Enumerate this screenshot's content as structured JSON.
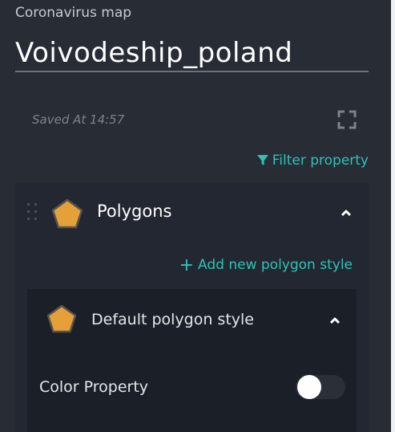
{
  "header": {
    "map_name": "Coronavirus map",
    "title": "Voivodeship_poland",
    "saved_text": "Saved At 14:57"
  },
  "toolbar": {
    "filter_label": "Filter property",
    "expand_icon": "expand-icon"
  },
  "layer": {
    "title": "Polygons",
    "icon": "pentagon-icon",
    "icon_color": "#e5a137",
    "add_style_label": "Add new polygon style",
    "style": {
      "title": "Default polygon style",
      "icon": "pentagon-icon",
      "icon_color": "#e5a137",
      "color_property_label": "Color Property",
      "color_property_enabled": false
    }
  },
  "colors": {
    "accent": "#2fc3b6",
    "background": "#272c35",
    "panel": "#222731",
    "inner_panel": "#1b1f27"
  }
}
